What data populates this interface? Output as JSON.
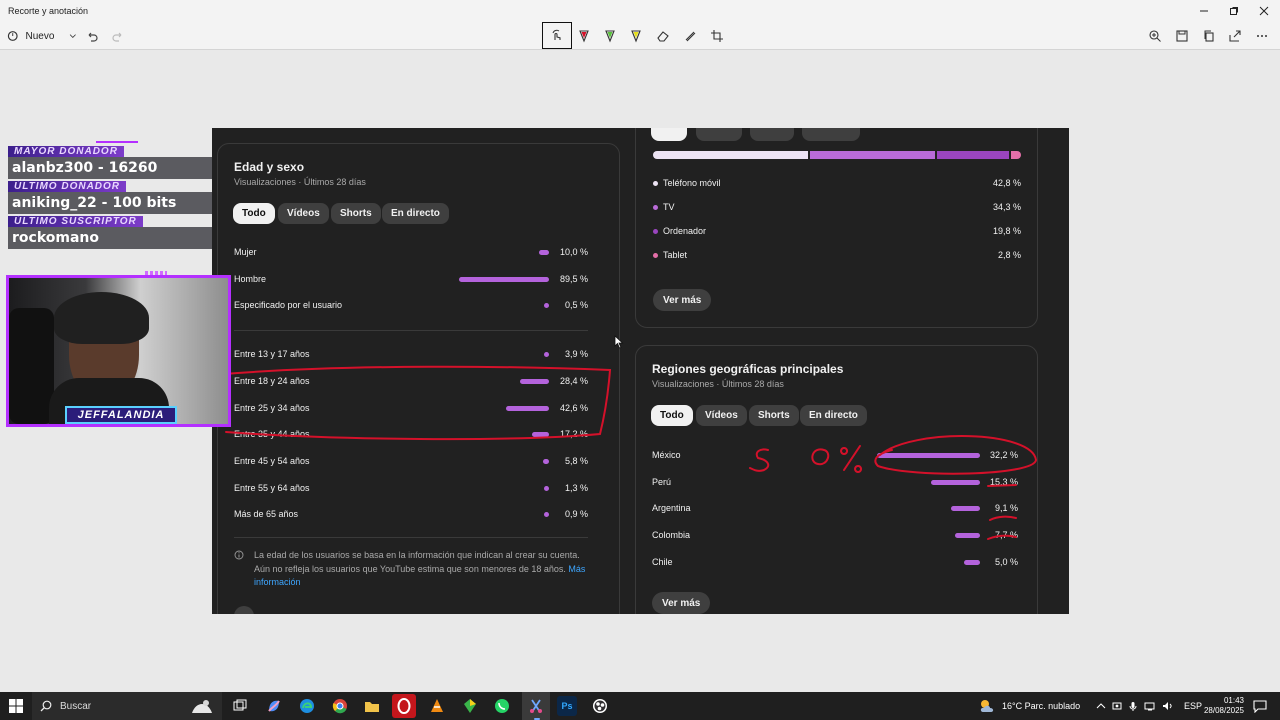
{
  "window": {
    "title": "Recorte y anotación"
  },
  "toolbar": {
    "new_label": "Nuevo"
  },
  "age_card": {
    "title": "Edad y sexo",
    "subtitle": "Visualizaciones · Últimos 28 días",
    "tabs": [
      "Todo",
      "Vídeos",
      "Shorts",
      "En directo"
    ],
    "gender": [
      {
        "label": "Mujer",
        "pct": "10,0 %",
        "value": 10.0
      },
      {
        "label": "Hombre",
        "pct": "89,5 %",
        "value": 89.5
      },
      {
        "label": "Especificado por el usuario",
        "pct": "0,5 %",
        "value": 0.5
      }
    ],
    "ages": [
      {
        "label": "Entre 13 y 17 años",
        "pct": "3,9 %",
        "value": 3.9
      },
      {
        "label": "Entre 18 y 24 años",
        "pct": "28,4 %",
        "value": 28.4
      },
      {
        "label": "Entre 25 y 34 años",
        "pct": "42,6 %",
        "value": 42.6
      },
      {
        "label": "Entre 35 y 44 años",
        "pct": "17,2 %",
        "value": 17.2
      },
      {
        "label": "Entre 45 y 54 años",
        "pct": "5,8 %",
        "value": 5.8
      },
      {
        "label": "Entre 55 y 64 años",
        "pct": "1,3 %",
        "value": 1.3
      },
      {
        "label": "Más de 65 años",
        "pct": "0,9 %",
        "value": 0.9
      }
    ],
    "note": "La edad de los usuarios se basa en la información que indican al crear su cuenta. Aún no refleja los usuarios que YouTube estima que son menores de 18 años.",
    "note_link": "Más información"
  },
  "device_card": {
    "devices": [
      {
        "label": "Teléfono móvil",
        "pct": "42,8 %",
        "value": 42.8,
        "color": "#ece3f3"
      },
      {
        "label": "TV",
        "pct": "34,3 %",
        "value": 34.3,
        "color": "#b96bd8"
      },
      {
        "label": "Ordenador",
        "pct": "19,8 %",
        "value": 19.8,
        "color": "#9a45bf"
      },
      {
        "label": "Tablet",
        "pct": "2,8 %",
        "value": 2.8,
        "color": "#e46fa8"
      }
    ],
    "more_label": "Ver más"
  },
  "geo_card": {
    "title": "Regiones geográficas principales",
    "subtitle": "Visualizaciones · Últimos 28 días",
    "tabs": [
      "Todo",
      "Vídeos",
      "Shorts",
      "En directo"
    ],
    "regions": [
      {
        "label": "México",
        "pct": "32,2 %",
        "value": 32.2
      },
      {
        "label": "Perú",
        "pct": "15,3 %",
        "value": 15.3
      },
      {
        "label": "Argentina",
        "pct": "9,1 %",
        "value": 9.1
      },
      {
        "label": "Colombia",
        "pct": "7,7 %",
        "value": 7.7
      },
      {
        "label": "Chile",
        "pct": "5,0 %",
        "value": 5.0
      }
    ],
    "more_label": "Ver más"
  },
  "overlay": {
    "top_donor_heading": "MAYOR DONADOR",
    "top_donor": "alanbz300 - 16260",
    "last_donor_heading": "ÚLTIMO DONADOR",
    "last_donor": "aniking_22 - 100 bits",
    "last_sub_heading": "ÚLTIMO SUSCRIPTOR",
    "last_sub": "rockomano",
    "webcam_name": "JEFFALANDIA"
  },
  "taskbar": {
    "search_label": "Buscar",
    "weather": "16°C  Parc. nublado",
    "lang": "ESP",
    "time": "01:43",
    "date": "28/08/2025"
  },
  "colors": {
    "bar": "#b463dc",
    "annotation": "#d4112a",
    "link": "#3ea6ff"
  }
}
